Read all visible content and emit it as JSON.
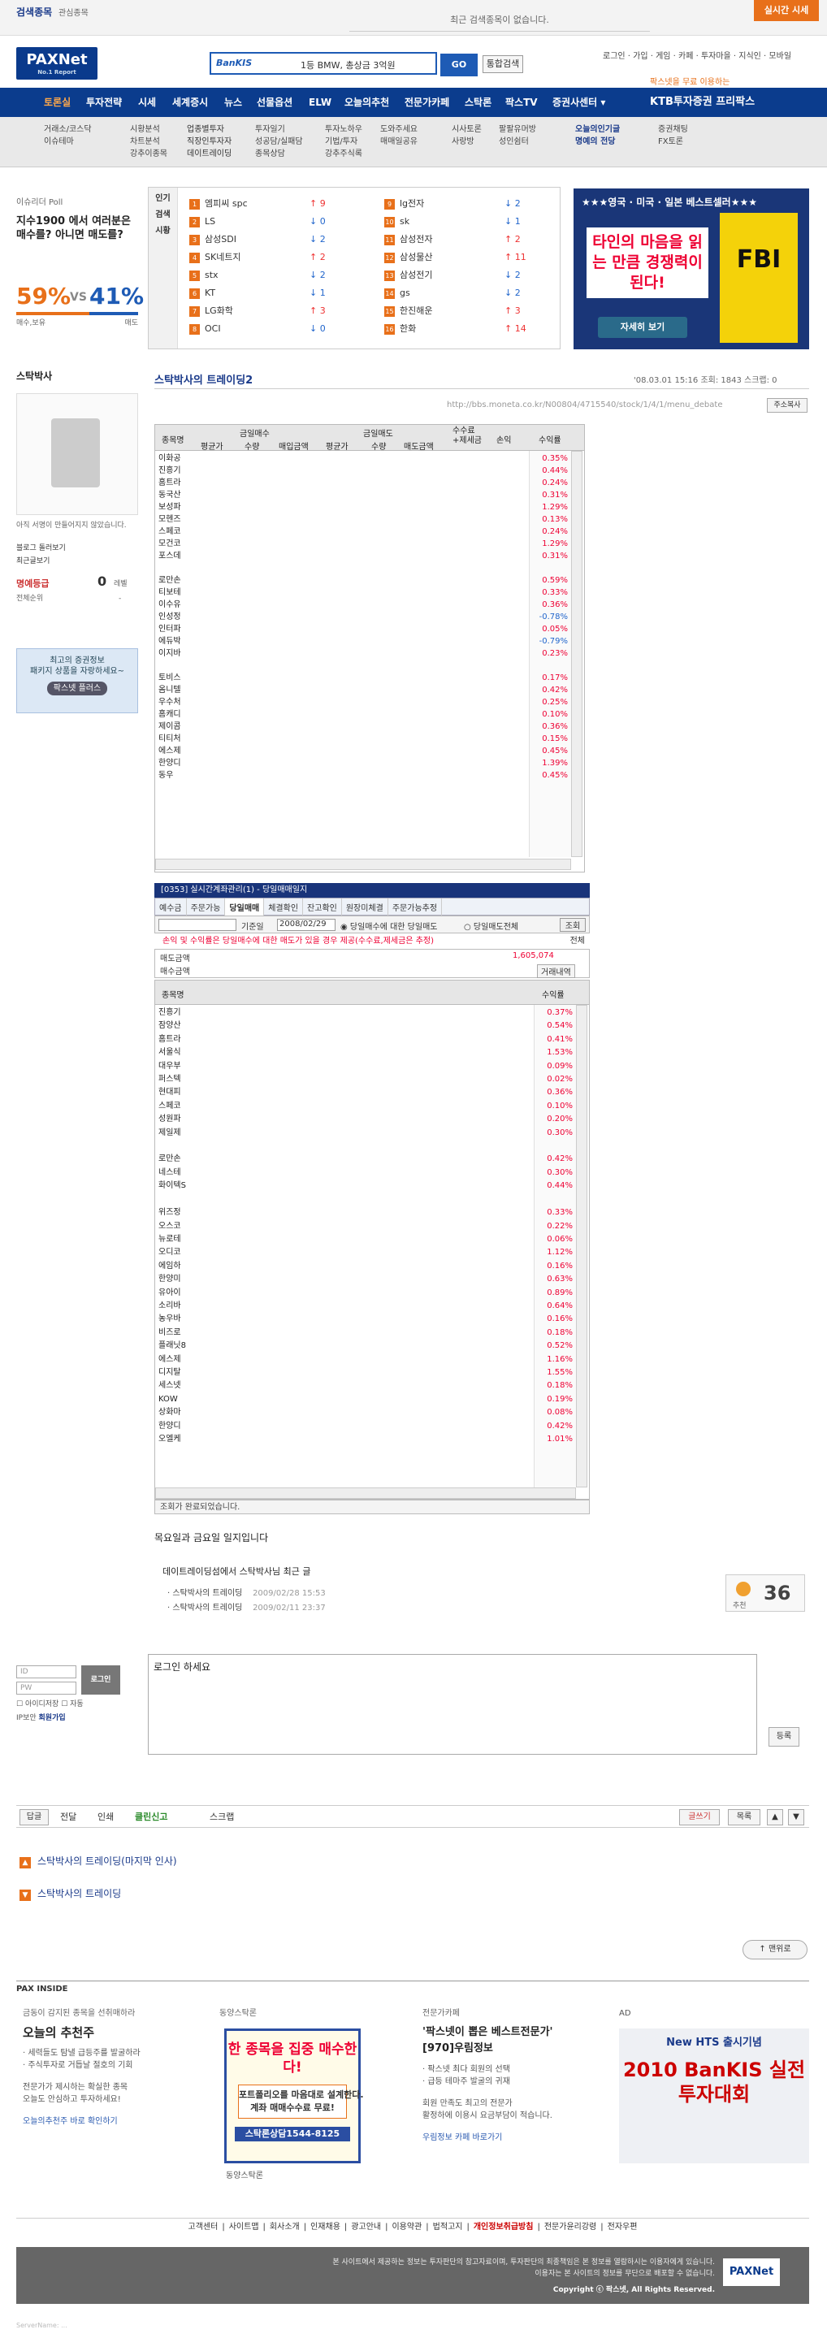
{
  "topbar": {
    "tab1": "검색종목",
    "tab2": "관심종목",
    "notice": "최근 검색종목이 없습니다.",
    "live": "실시간 시세"
  },
  "header": {
    "logo": "PAXNet",
    "logo_sub": "No.1 Report",
    "search_brand": "BanKIS",
    "search_text": "1등 BMW, 총상금 3억원",
    "go": "GO",
    "full_search": "통합검색",
    "user_links": "로그인 · 가입 · 게임 · 카페 · 투자마을 · 지식인 · 모바일",
    "free_use": "팍스넷을 무료 이용하는"
  },
  "nav": {
    "items": [
      "토론실",
      "투자전략",
      "시세",
      "세계증시",
      "뉴스",
      "선물옵션",
      "ELW",
      "오늘의추천",
      "전문가카페",
      "스탁론",
      "팍스TV",
      "증권사센터 ▾"
    ],
    "ktb": "KTB투자증권 프리팍스"
  },
  "subnav": {
    "c1": "거래소/코스닥\n이슈테마",
    "c2": "시황분석\n차트분석\n강추이종목",
    "c3": "업종별투자\n직장인투자자\n데이트레이딩",
    "c4": "투자일기\n성공담/실패담\n종목상담",
    "c5": "투자노하우\n기법/투자\n강추주식록",
    "c6": "도와주세요\n매매일공유",
    "c7": "시사토론\n사랑방",
    "c8": "팔팔유머방\n성인쉼터",
    "c9": "오늘의인기글\n명예의 전당",
    "c10": "증권채팅\nFX토론"
  },
  "poll": {
    "head": "이슈리더 Poll",
    "question": "지수1900 에서 여러분은 매수를? 아니면 매도를?",
    "buy_pct": "59%",
    "vs": "VS",
    "sell_pct": "41%",
    "buy_lbl": "매수,보유",
    "sell_lbl": "매도"
  },
  "ticker": {
    "side": "인기\n검색\n시황",
    "left": [
      {
        "n": "1",
        "name": "엠피씨 spc",
        "ch": "9",
        "d": "up"
      },
      {
        "n": "2",
        "name": "LS",
        "ch": "0",
        "d": "dn"
      },
      {
        "n": "3",
        "name": "삼성SDI",
        "ch": "2",
        "d": "dn"
      },
      {
        "n": "4",
        "name": "SK네트지",
        "ch": "2",
        "d": "up"
      },
      {
        "n": "5",
        "name": "stx",
        "ch": "2",
        "d": "dn"
      },
      {
        "n": "6",
        "name": "KT",
        "ch": "1",
        "d": "dn"
      },
      {
        "n": "7",
        "name": "LG화학",
        "ch": "3",
        "d": "up"
      },
      {
        "n": "8",
        "name": "OCI",
        "ch": "0",
        "d": "dn"
      }
    ],
    "right": [
      {
        "n": "9",
        "name": "lg전자",
        "ch": "2",
        "d": "dn"
      },
      {
        "n": "10",
        "name": "sk",
        "ch": "1",
        "d": "dn"
      },
      {
        "n": "11",
        "name": "삼성전자",
        "ch": "2",
        "d": "up"
      },
      {
        "n": "12",
        "name": "삼성물산",
        "ch": "11",
        "d": "up"
      },
      {
        "n": "13",
        "name": "삼성전기",
        "ch": "2",
        "d": "dn"
      },
      {
        "n": "14",
        "name": "gs",
        "ch": "2",
        "d": "dn"
      },
      {
        "n": "15",
        "name": "한진해운",
        "ch": "3",
        "d": "up"
      },
      {
        "n": "16",
        "name": "한화",
        "ch": "14",
        "d": "up"
      }
    ]
  },
  "book_ad": {
    "head": "★★★영국 · 미국 · 일본 베스트셀러★★★",
    "tagline": "타인의 마음을 읽는 만큼 경쟁력이 된다!",
    "btn": "자세히 보기",
    "book": "FBI"
  },
  "profile": {
    "title": "스탁박사",
    "intro": "아직 서명이 만들어지지 않았습니다.",
    "blog": "블로그 돌러보기",
    "recent": "최근글보기",
    "honor_label": "명예등급",
    "honor_val": "0",
    "honor_unit": "레벨",
    "rank_label": "전체순위",
    "rank_val": "-",
    "banner": "최고의 증권정보\n패키지 상품을 자랑하세요~",
    "banner_btn": "팍스넷 플러스"
  },
  "post": {
    "title": "스탁박사의 트레이딩2",
    "meta": "'08.03.01 15:16  조회: 1843  스크랩: 0",
    "url": "http://bbs.moneta.co.kr/N00804/4715540/stock/1/4/1/menu_debate",
    "url_copy": "주소복사"
  },
  "grid1": {
    "headers": [
      "종목명",
      "금일매수",
      "금일매도",
      "수수료\n+제세금",
      "손익",
      "수익률"
    ],
    "subheaders": [
      "평균가",
      "수량",
      "매입금액",
      "평균가",
      "수량",
      "매도금액"
    ],
    "names": [
      "이화공",
      "진흥기",
      "홈트라",
      "동국산",
      "보성파",
      "모헨즈",
      "스페코",
      "모건코",
      "포스데",
      "",
      "로만손",
      "티보테",
      "이수유",
      "인성정",
      "인터파",
      "에듀박",
      "이지바",
      "",
      "토비스",
      "옴니텔",
      "우수처",
      "홈캐디",
      "제이콤",
      "티티처",
      "에스제",
      "한양디",
      "동우"
    ],
    "rates": [
      "0.35%",
      "0.44%",
      "0.24%",
      "0.31%",
      "1.29%",
      "0.13%",
      "0.24%",
      "1.29%",
      "0.31%",
      "",
      "0.59%",
      "0.33%",
      "0.36%",
      "-0.78%",
      "0.05%",
      "-0.79%",
      "0.23%",
      "",
      "0.17%",
      "0.42%",
      "0.25%",
      "0.10%",
      "0.36%",
      "0.15%",
      "0.45%",
      "1.39%",
      "0.45%"
    ]
  },
  "win2": {
    "title": "[0353] 실시간계좌관리(1) - 당일매매일지",
    "tabs": [
      "예수금",
      "주문가능",
      "당일매매",
      "체결확인",
      "잔고확인",
      "원장미체결",
      "주문가능추정"
    ],
    "date_lbl": "기준일",
    "date": "2008/02/29",
    "opt1": "당일매수에 대한 당일매도",
    "opt2": "당일매도전체",
    "btn": "조회",
    "warn": "손익 및 수익률은 당일매수에 대한 매도가 있을 경우 제공(수수료,제세금은 추정)",
    "total": "전체",
    "sell_lbl": "매도금액",
    "sell_val": "1,605,074",
    "buy_lbl": "매수금액",
    "trade_lbl": "거래내역"
  },
  "grid2": {
    "headers": [
      "종목명",
      "수익률"
    ],
    "names": [
      "진흥기",
      "잠양산",
      "홈트라",
      "서울식",
      "대우부",
      "퍼스텍",
      "현대피",
      "스페코",
      "성원파",
      "제일제",
      "",
      "로만손",
      "네스테",
      "화이텍S",
      "",
      "위즈정",
      "오스코",
      "뉴로테",
      "오디코",
      "에임하",
      "한양미",
      "유아이",
      "소리바",
      "농우바",
      "비즈로",
      "플래닛8",
      "에스제",
      "디지탈",
      "세스넷",
      "KOW",
      "상화마",
      "한양디",
      "오엘케"
    ],
    "rates": [
      "0.37%",
      "0.54%",
      "0.41%",
      "1.53%",
      "0.09%",
      "0.02%",
      "0.36%",
      "0.10%",
      "0.20%",
      "0.30%",
      "",
      "0.42%",
      "0.30%",
      "0.44%",
      "",
      "0.33%",
      "0.22%",
      "0.06%",
      "1.12%",
      "0.16%",
      "0.63%",
      "0.89%",
      "0.64%",
      "0.16%",
      "0.18%",
      "0.52%",
      "1.16%",
      "1.55%",
      "0.18%",
      "0.19%",
      "0.08%",
      "0.42%",
      "1.01%"
    ]
  },
  "status": "조회가 완료되었습니다.",
  "body": "목요일과 금요일 일지입니다",
  "related": {
    "title": "데이트레이딩섬에서 스탁박사님 최근 글",
    "items": [
      {
        "t": "스탁박사의 트레이딩",
        "d": "2009/02/28 15:53"
      },
      {
        "t": "스탁박사의 트레이딩",
        "d": "2009/02/11 23:37"
      }
    ]
  },
  "recommend": {
    "count": "36",
    "label": "추천"
  },
  "comment": {
    "id_ph": "ID",
    "pw_ph": "PW",
    "login": "로그인",
    "save_id": "아이디저장",
    "auto": "자동",
    "ip": "IP보안",
    "join": "회원가입",
    "placeholder": "로그인 하세요",
    "submit": "등록"
  },
  "actions": {
    "reply": "답글",
    "forward": "전달",
    "print": "인쇄",
    "clean": "클린신고",
    "scrap": "스크랩",
    "write": "글쓰기",
    "list": "목록"
  },
  "prev": "스탁박사의 트레이딩(마지막 인사)",
  "next": "스탁박사의 트레이딩",
  "totop": "맨위로",
  "paxinside": {
    "label": "PAX INSIDE",
    "c1h": "금동이 감지된 종목을 선취매하라",
    "c1big": "오늘의 추천주",
    "c1l1": "· 세력들도 탐낼 급등주를 발굴하라",
    "c1l2": "· 주식투자로 거듭날 절호의 기회",
    "c1desc": "전문가가 제시하는 확실한 종목\n오늘도 안심하고 투자하세요!",
    "c1link": "오늘의추천주 바로 확인하기",
    "c2h": "동양스탁론",
    "c2ad": "한 종목을 집중 매수한다!",
    "c2ph": "포트폴리오를 마음대로 설계한다.\n계좌 매매수수료 무료!",
    "c2tel": "스탁론상담1544-8125",
    "c2link": "동양스탁론",
    "c3h": "전문가카페",
    "c3big": "'팍스넷이 뽑은 베스트전문가'\n[970]우림정보",
    "c3l1": "· 팍스넷 최다 회원의 선택",
    "c3l2": "· 급등 테마주 발굴의 귀재",
    "c3desc": "회원 만족도 최고의 전문가\n활정하에 이용시 요금부담이 적습니다.",
    "c3link": "우림정보 카페 바로가기",
    "c4h": "AD",
    "c4a": "New HTS 출시기념",
    "c4b": "2010 BanKIS 실전투자대회"
  },
  "footer": {
    "links": [
      "고객센터",
      "사이트맵",
      "회사소개",
      "인재채용",
      "광고안내",
      "이용약관",
      "법적고지",
      "개인정보취급방침",
      "전문가윤리강령",
      "전자우편"
    ],
    "disclaimer": "본 사이트에서 제공하는 정보는 투자판단의 참고자료이며, 투자판단의 최종책임은 본 정보를 열람하시는 이용자에게 있습니다.\n이용자는 본 사이트의 정보를 무단으로 배포할 수 없습니다.",
    "copyright": "Copyright ⓒ 팍스넷, All Rights Reserved.",
    "logo": "PAXNet",
    "note": "ServerName: ..."
  },
  "colors": {
    "navy": "#0b3c8d",
    "orange": "#e8701a",
    "red": "#e03",
    "blue": "#26c"
  }
}
